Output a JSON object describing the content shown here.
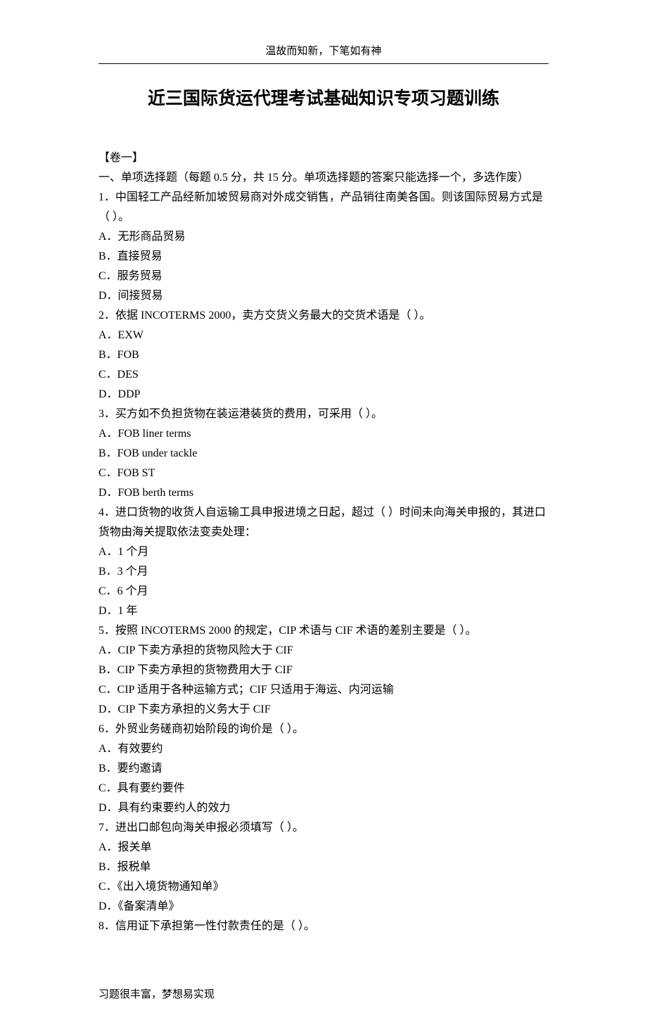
{
  "header": "温故而知新，下笔如有神",
  "title": "近三国际货运代理考试基础知识专项习题训练",
  "section_label": "【卷一】",
  "instructions": "一、单项选择题（每题 0.5 分，共 15 分。单项选择题的答案只能选择一个，多选作废）",
  "questions": [
    {
      "stem": "1．中国轻工产品经新加坡贸易商对外成交销售，产品销往南美各国。则该国际贸易方式是（ ）。",
      "stem_extra": "",
      "options": [
        "A．无形商品贸易",
        "B．直接贸易",
        "C．服务贸易",
        "D．间接贸易"
      ]
    },
    {
      "stem": "2．依据 INCOTERMS 2000，卖方交货义务最大的交货术语是（ ）。",
      "options": [
        "A．EXW",
        "B．FOB",
        "C．DES",
        "D．DDP"
      ]
    },
    {
      "stem": "3．买方如不负担货物在装运港装货的费用，可采用（ ）。",
      "options": [
        "A．FOB liner terms",
        "B．FOB under tackle",
        "C．FOB ST",
        "D．FOB berth terms"
      ]
    },
    {
      "stem": "4．进口货物的收货人自运输工具申报进境之日起，超过（ ）时间未向海关申报的，其进口货物由海关提取依法变卖处理：",
      "options": [
        "A．1 个月",
        "B．3 个月",
        "C．6 个月",
        "D．1 年"
      ]
    },
    {
      "stem": "5．按照 INCOTERMS 2000 的规定，CIP 术语与 CIF 术语的差别主要是（ ）。",
      "options": [
        "A．CIP 下卖方承担的货物风险大于 CIF",
        "B．CIP 下卖方承担的货物费用大于 CIF",
        "C．CIP 适用于各种运输方式；CIF 只适用于海运、内河运输",
        "D．CIP 下卖方承担的义务大于 CIF"
      ]
    },
    {
      "stem": "6．外贸业务磋商初始阶段的询价是（ ）。",
      "options": [
        "A．有效要约",
        "B．要约邀请",
        "C．具有要约要件",
        "D．具有约束要约人的效力"
      ]
    },
    {
      "stem": "7．进出口邮包向海关申报必须填写（ ）。",
      "options": [
        "A．报关单",
        "B．报税单",
        "C．《出入境货物通知单》",
        "D．《备案清单》"
      ]
    },
    {
      "stem": "8．信用证下承担第一性付款责任的是（ ）。",
      "options": []
    }
  ],
  "footer": "习题很丰富，梦想易实现"
}
